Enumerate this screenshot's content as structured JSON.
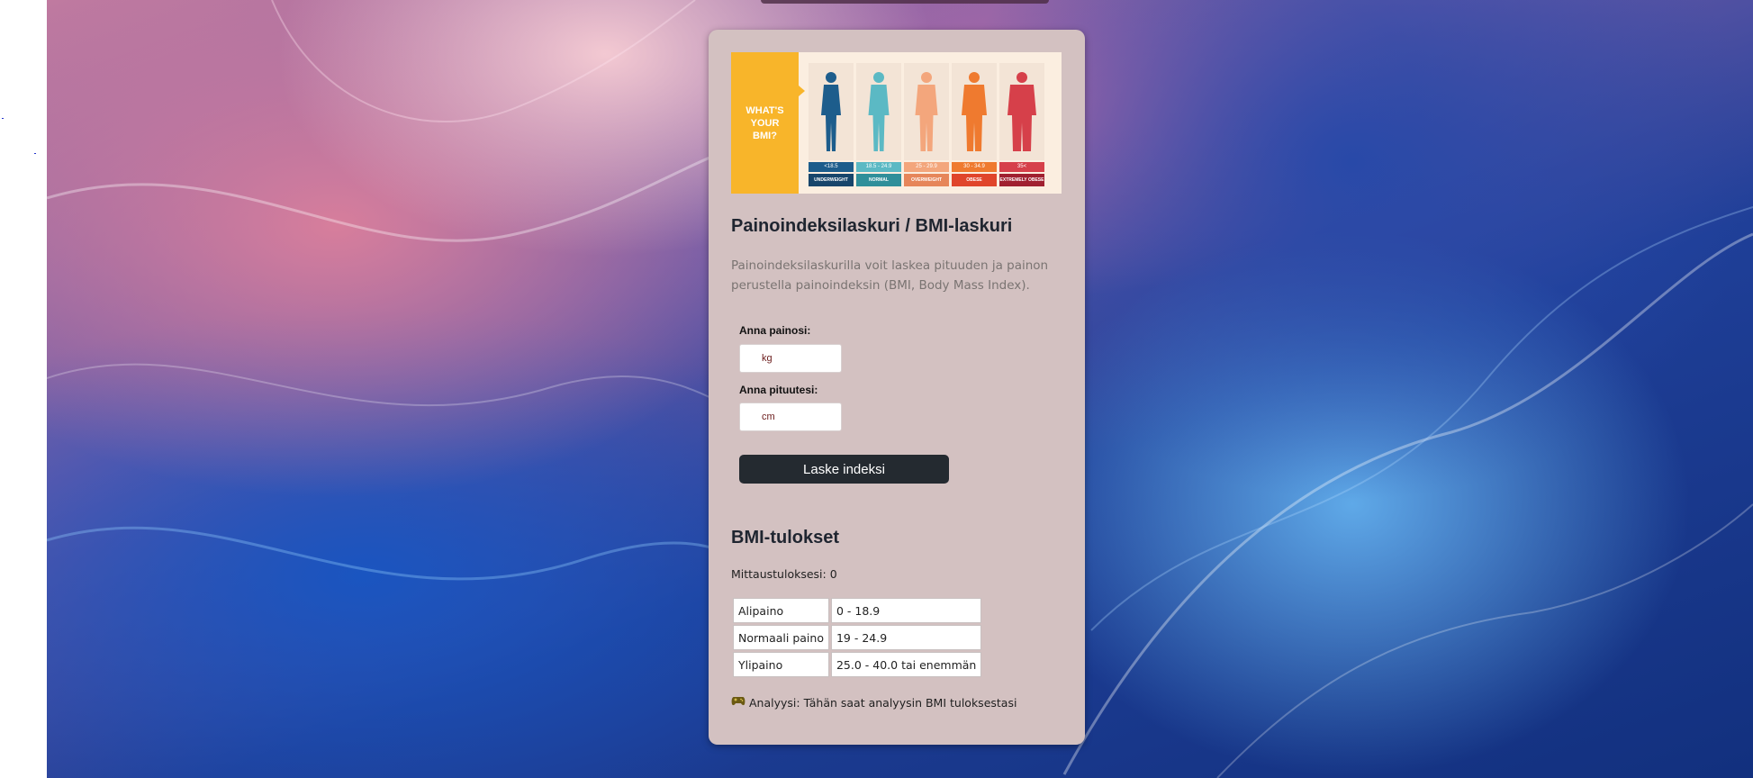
{
  "hero": {
    "heading": "WHAT'S\nYOUR\nBMI?",
    "figures": [
      {
        "range": "<18.5",
        "label": "UNDERWEIGHT",
        "color": "#1d5d8c",
        "band": "#17456b"
      },
      {
        "range": "18.5 - 24.9",
        "label": "NORMAL",
        "color": "#5bb9c4",
        "band": "#2f8f9a"
      },
      {
        "range": "25 - 29.9",
        "label": "OVERWEIGHT",
        "color": "#f3a67c",
        "band": "#e6865a"
      },
      {
        "range": "30 - 34.9",
        "label": "OBESE",
        "color": "#ef7a2f",
        "band": "#e0452b"
      },
      {
        "range": "35<",
        "label": "EXTREMELY OBESE",
        "color": "#d6404a",
        "band": "#a02030"
      }
    ]
  },
  "calculator": {
    "title": "Painoindeksilaskuri / BMI-laskuri",
    "description": "Painoindeksilaskurilla voit laskea pituuden ja painon perustella painoindeksin (BMI, Body Mass Index).",
    "weight_label": "Anna painosi:",
    "weight_placeholder": "kg",
    "height_label": "Anna pituutesi:",
    "height_placeholder": "cm",
    "button_label": "Laske indeksi"
  },
  "results": {
    "title": "BMI-tulokset",
    "measurement": "Mittaustuloksesi: 0",
    "rows": [
      {
        "category": "Alipaino",
        "range": "0 - 18.9"
      },
      {
        "category": "Normaali paino",
        "range": "19 - 24.9"
      },
      {
        "category": "Ylipaino",
        "range": "25.0 - 40.0 tai enemmän"
      }
    ],
    "analysis_icon": "gamepad-icon",
    "analysis": "Analyysi: Tähän saat analyysin BMI tuloksestasi"
  }
}
